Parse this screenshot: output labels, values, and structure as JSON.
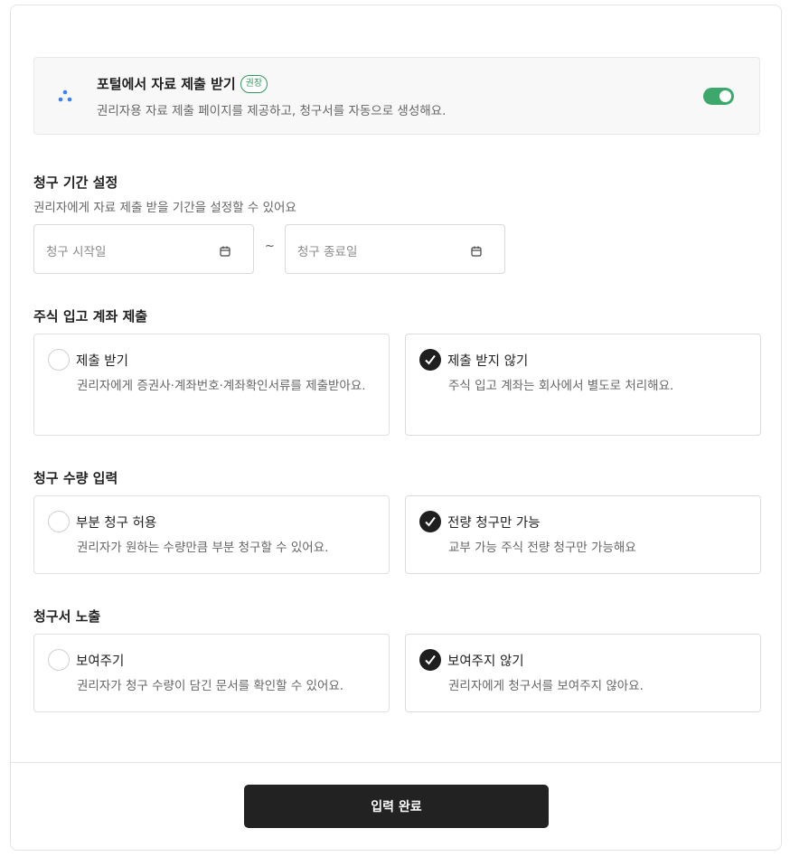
{
  "portal": {
    "title": "포털에서 자료 제출 받기",
    "badge": "권장",
    "description": "권리자용 자료 제출 페이지를 제공하고, 청구서를 자동으로 생성해요.",
    "toggle_on": true,
    "accent_color": "#3da86b"
  },
  "period": {
    "title": "청구 기간 설정",
    "description": "권리자에게 자료 제출 받을 기간을 설정할 수 있어요",
    "start_placeholder": "청구 시작일",
    "separator": "~",
    "end_placeholder": "청구 종료일"
  },
  "account": {
    "title": "주식 입고 계좌 제출",
    "options": [
      {
        "label": "제출 받기",
        "description": "권리자에게 증권사·계좌번호·계좌확인서류를 제출받아요.",
        "selected": false
      },
      {
        "label": "제출 받지 않기",
        "description": "주식 입고 계좌는 회사에서 별도로 처리해요.",
        "selected": true
      }
    ]
  },
  "quantity": {
    "title": "청구 수량 입력",
    "options": [
      {
        "label": "부분 청구 허용",
        "description": "권리자가 원하는 수량만큼 부분 청구할 수 있어요.",
        "selected": false
      },
      {
        "label": "전량 청구만 가능",
        "description": "교부 가능 주식 전량 청구만 가능해요",
        "selected": true
      }
    ]
  },
  "exposure": {
    "title": "청구서 노출",
    "options": [
      {
        "label": "보여주기",
        "description": "권리자가 청구 수량이 담긴 문서를 확인할 수 있어요.",
        "selected": false
      },
      {
        "label": "보여주지 않기",
        "description": "권리자에게 청구서를 보여주지 않아요.",
        "selected": true
      }
    ]
  },
  "submit_label": "입력 완료"
}
